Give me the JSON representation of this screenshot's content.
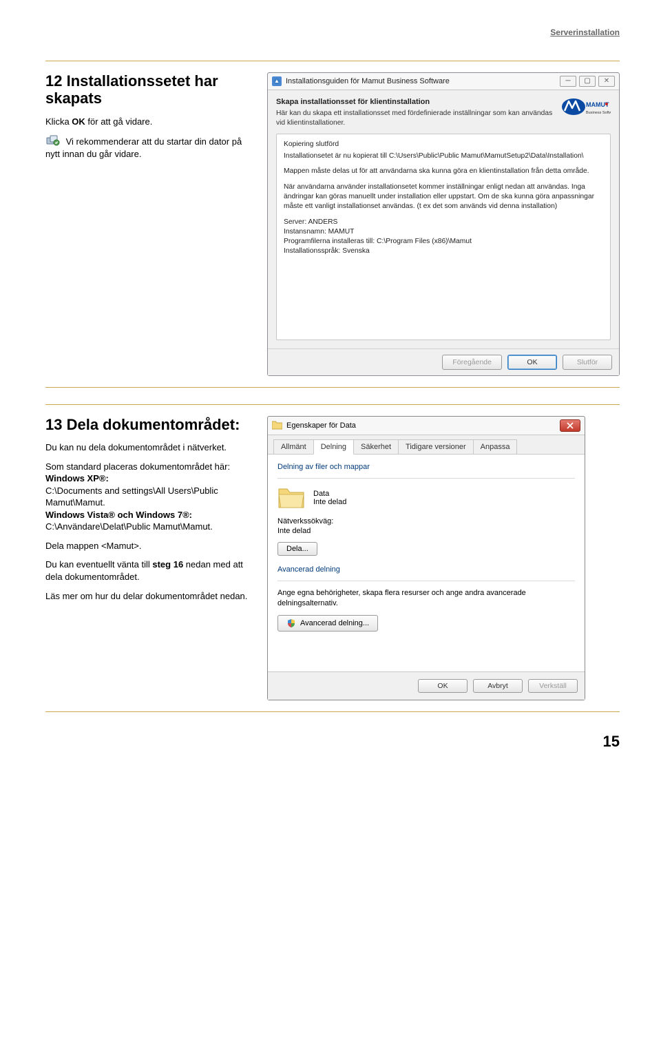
{
  "header": {
    "breadcrumb": "Serverinstallation",
    "page_number": "15"
  },
  "section12": {
    "title": "12 Installationssetet har skapats",
    "p1a": "Klicka ",
    "p1b": "OK",
    "p1c": " för att gå vidare.",
    "p2": "Vi rekommenderar att du startar din dator på nytt innan du går vidare."
  },
  "wizard": {
    "title": "Installationsguiden för Mamut Business Software",
    "section_title": "Skapa installationsset för klientinstallation",
    "section_sub": "Här kan du skapa ett installationsset med fördefinierade inställningar som kan användas vid klientinstallationer.",
    "logo_brand": "MAMUT",
    "logo_sub": "Business Software",
    "copy_label": "Kopiering slutförd",
    "copy_text": "Installationsetet är nu kopierat till C:\\Users\\Public\\Public Mamut\\MamutSetup2\\Data\\Installation\\",
    "copy_text2": "Mappen måste delas ut för att användarna ska kunna göra en klientinstallation från detta område.",
    "copy_text3": "När användarna använder installationsetet kommer inställningar enligt nedan att användas. Inga ändringar kan göras manuellt under installation eller uppstart. Om de ska kunna göra anpassningar måste ett vanligt installationset användas. (t ex det som används vid denna installation)",
    "server": "Server: ANDERS",
    "instance": "Instansnamn: MAMUT",
    "progfiles": "Programfilerna installeras till: C:\\Program Files (x86)\\Mamut",
    "lang": "Installationsspråk: Svenska",
    "btn_prev": "Föregående",
    "btn_ok": "OK",
    "btn_finish": "Slutför"
  },
  "section13": {
    "title": "13 Dela dokumentområdet:",
    "p1": "Du kan nu dela dokumentområdet i nätverket.",
    "p2a": "Som standard placeras dokumentområdet här:",
    "p2_xp_label": "Windows XP®:",
    "p2_xp_path": "C:\\Documents and settings\\All Users\\Public Mamut\\Mamut.",
    "p2_vista_label": "Windows Vista® och Windows 7®:",
    "p2_vista_path": "C:\\Användare\\Delat\\Public Mamut\\Mamut.",
    "p3": "Dela mappen <Mamut>.",
    "p4a": "Du kan eventuellt vänta till ",
    "p4b": "steg 16",
    "p4c": " nedan med att dela dokumentområdet.",
    "p5": "Läs mer om hur du delar dokumentområdet nedan."
  },
  "dialog": {
    "title": "Egenskaper för Data",
    "tabs": {
      "allmant": "Allmänt",
      "delning": "Delning",
      "sakerhet": "Säkerhet",
      "tidigare": "Tidigare versioner",
      "anpassa": "Anpassa"
    },
    "group1_title": "Delning av filer och mappar",
    "share_name": "Data",
    "share_status": "Inte delad",
    "netpath_label": "Nätverkssökväg:",
    "netpath_value": "Inte delad",
    "share_btn": "Dela...",
    "group2_title": "Avancerad delning",
    "group2_text": "Ange egna behörigheter, skapa flera resurser och ange andra avancerade delningsalternativ.",
    "adv_btn": "Avancerad delning...",
    "btn_ok": "OK",
    "btn_cancel": "Avbryt",
    "btn_apply": "Verkställ"
  }
}
